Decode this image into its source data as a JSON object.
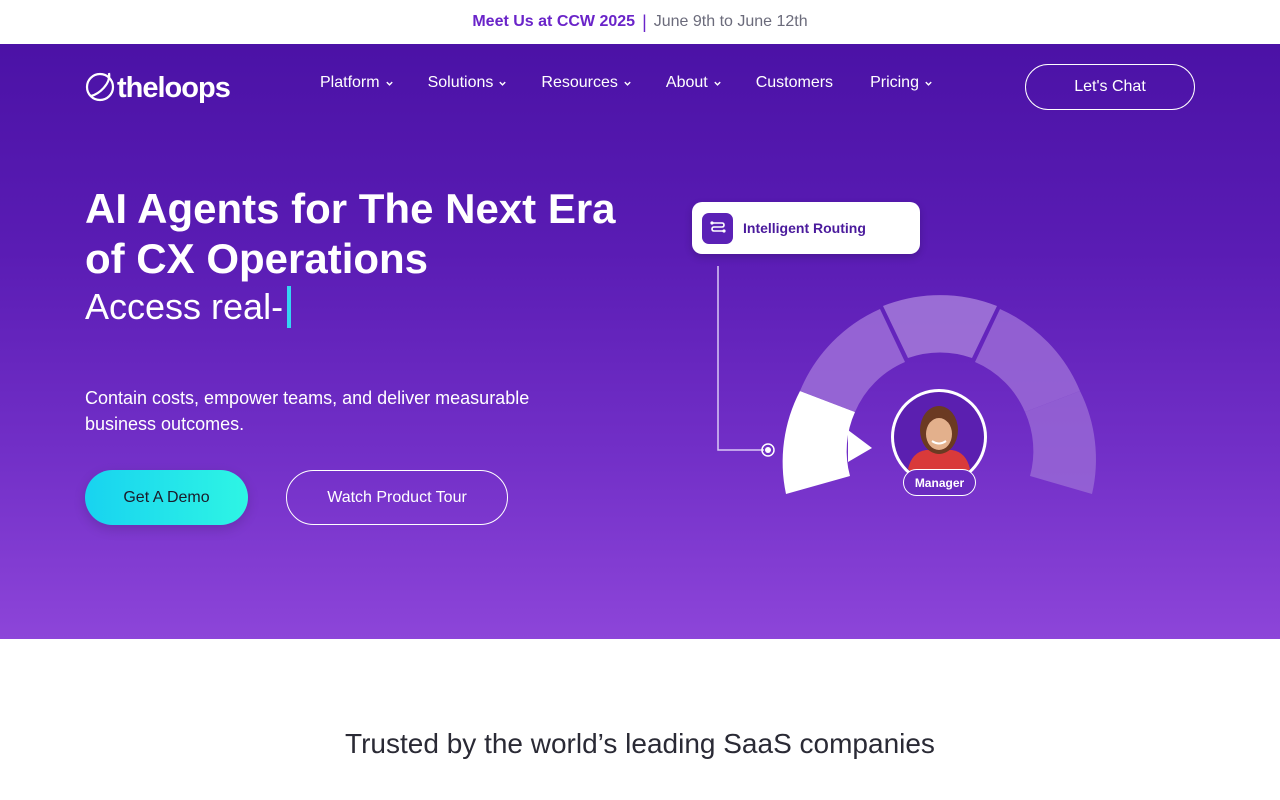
{
  "announcement": {
    "highlight": "Meet Us at CCW 2025",
    "separator": "|",
    "dates": "June 9th to June 12th"
  },
  "brand": {
    "name": "theloops"
  },
  "nav": {
    "items": [
      {
        "label": "Platform",
        "has_dropdown": true
      },
      {
        "label": "Solutions",
        "has_dropdown": true
      },
      {
        "label": "Resources",
        "has_dropdown": true
      },
      {
        "label": "About",
        "has_dropdown": true
      },
      {
        "label": "Customers",
        "has_dropdown": false
      },
      {
        "label": "Pricing",
        "has_dropdown": true
      }
    ],
    "cta": "Let's Chat"
  },
  "hero": {
    "headline": "AI Agents for The Next Era of CX Operations",
    "typed_text": "Access real-",
    "subtitle": "Contain costs, empower teams, and deliver measurable business outcomes.",
    "primary_button": "Get A Demo",
    "secondary_button": "Watch Product Tour"
  },
  "illustration": {
    "card_label": "Intelligent Routing",
    "badge_label": "Manager"
  },
  "trusted": {
    "heading": "Trusted by the world’s leading SaaS companies"
  },
  "colors": {
    "accent": "#6a24c9",
    "hero_top": "#4b12a6",
    "hero_bottom": "#8d45d9",
    "cta_cyan": "#18d3f0",
    "cursor": "#35d4f3"
  },
  "icons": [
    "logo-mark",
    "chevron-down-icon",
    "routing-icon",
    "manager-avatar"
  ]
}
